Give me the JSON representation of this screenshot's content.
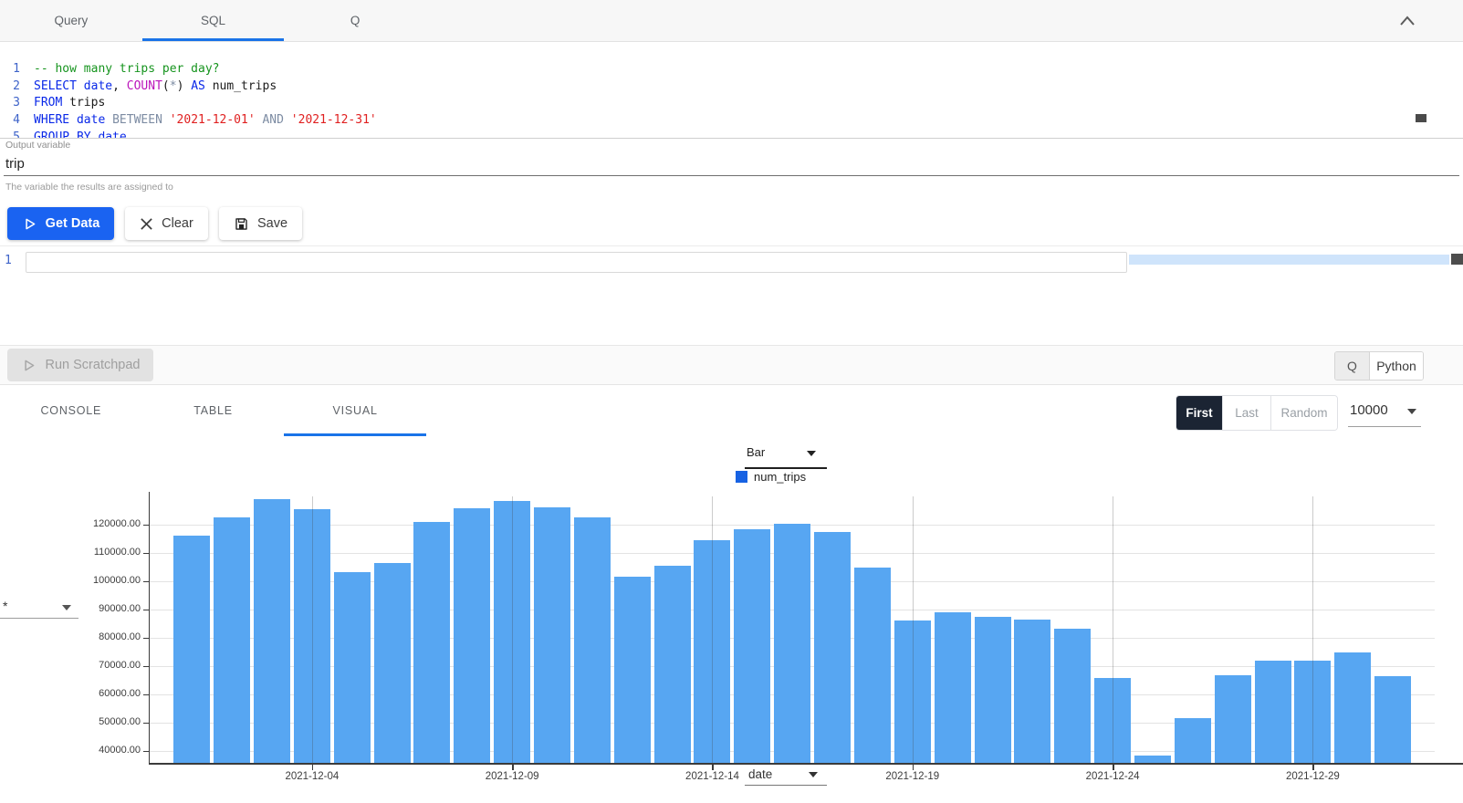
{
  "top_tabs": {
    "items": [
      {
        "label": "Query",
        "active": false
      },
      {
        "label": "SQL",
        "active": true
      },
      {
        "label": "Q",
        "active": false
      }
    ],
    "collapse_icon": "chevron-up",
    "accent_color": "#1a73e8"
  },
  "sql_editor": {
    "lines": [
      {
        "num": "1",
        "tokens": [
          [
            "-- how many trips per day?",
            "comment"
          ]
        ]
      },
      {
        "num": "2",
        "tokens": [
          [
            "SELECT",
            "kw"
          ],
          [
            " ",
            "pl"
          ],
          [
            "date",
            "kw"
          ],
          [
            ", ",
            "pl"
          ],
          [
            "COUNT",
            "fn"
          ],
          [
            "(",
            "pl"
          ],
          [
            "*",
            "op"
          ],
          [
            ") ",
            "pl"
          ],
          [
            "AS",
            "kw"
          ],
          [
            " num_trips",
            "pl"
          ]
        ]
      },
      {
        "num": "3",
        "tokens": [
          [
            "FROM",
            "kw"
          ],
          [
            " trips",
            "pl"
          ]
        ]
      },
      {
        "num": "4",
        "tokens": [
          [
            "WHERE",
            "kw"
          ],
          [
            " ",
            "pl"
          ],
          [
            "date",
            "kw"
          ],
          [
            " ",
            "pl"
          ],
          [
            "BETWEEN",
            "op"
          ],
          [
            " ",
            "pl"
          ],
          [
            "'2021-12-01'",
            "str"
          ],
          [
            " ",
            "pl"
          ],
          [
            "AND",
            "op"
          ],
          [
            " ",
            "pl"
          ],
          [
            "'2021-12-31'",
            "str"
          ]
        ]
      },
      {
        "num": "5",
        "tokens": [
          [
            "GROUP BY",
            "kw"
          ],
          [
            " date",
            "kw"
          ]
        ]
      }
    ]
  },
  "output_variable": {
    "label": "Output variable",
    "value": "trip",
    "helper": "The variable the results are assigned to"
  },
  "actions": {
    "get_data": "Get Data",
    "clear": "Clear",
    "save": "Save"
  },
  "scratchpad": {
    "line_number": "1",
    "value": ""
  },
  "run_bar": {
    "run_button": "Run Scratchpad",
    "q_label": "Q",
    "python_label": "Python"
  },
  "results_bar": {
    "tabs": [
      {
        "label": "CONSOLE",
        "active": false
      },
      {
        "label": "TABLE",
        "active": false
      },
      {
        "label": "VISUAL",
        "active": true
      }
    ],
    "sampling": {
      "first": "First",
      "last": "Last",
      "random": "Random",
      "selected": "First"
    },
    "limit": "10000"
  },
  "chart_controls": {
    "chart_type": "Bar",
    "series_select": "*",
    "x_axis_select": "date"
  },
  "chart_data": {
    "type": "bar",
    "series": [
      {
        "name": "num_trips",
        "color": "#57a6f2",
        "legend_color": "#1762e3"
      }
    ],
    "x": [
      "2021-12-01",
      "2021-12-02",
      "2021-12-03",
      "2021-12-04",
      "2021-12-05",
      "2021-12-06",
      "2021-12-07",
      "2021-12-08",
      "2021-12-09",
      "2021-12-10",
      "2021-12-11",
      "2021-12-12",
      "2021-12-13",
      "2021-12-14",
      "2021-12-15",
      "2021-12-16",
      "2021-12-17",
      "2021-12-18",
      "2021-12-19",
      "2021-12-20",
      "2021-12-21",
      "2021-12-22",
      "2021-12-23",
      "2021-12-24",
      "2021-12-25",
      "2021-12-26",
      "2021-12-27",
      "2021-12-28",
      "2021-12-29",
      "2021-12-30",
      "2021-12-31"
    ],
    "values": [
      116000,
      122600,
      129000,
      125500,
      103100,
      106400,
      120900,
      125800,
      128400,
      126200,
      122500,
      101600,
      105400,
      114600,
      118500,
      120400,
      117400,
      104700,
      86200,
      89100,
      87500,
      86600,
      83200,
      65800,
      38300,
      51500,
      66900,
      72000,
      71800,
      74900,
      66600
    ],
    "xlabel": "date",
    "ylabel": "",
    "y_ticks": [
      "40000.00",
      "50000.00",
      "60000.00",
      "70000.00",
      "80000.00",
      "90000.00",
      "100000.00",
      "110000.00",
      "120000.00"
    ],
    "x_ticks": [
      {
        "label": "2021-12-04",
        "day": 4
      },
      {
        "label": "2021-12-09",
        "day": 9
      },
      {
        "label": "2021-12-14",
        "day": 14
      },
      {
        "label": "2021-12-19",
        "day": 19
      },
      {
        "label": "2021-12-24",
        "day": 24
      },
      {
        "label": "2021-12-29",
        "day": 29
      }
    ],
    "ylim": [
      35800,
      131600
    ],
    "grid": true,
    "legend_position": "top-center"
  }
}
